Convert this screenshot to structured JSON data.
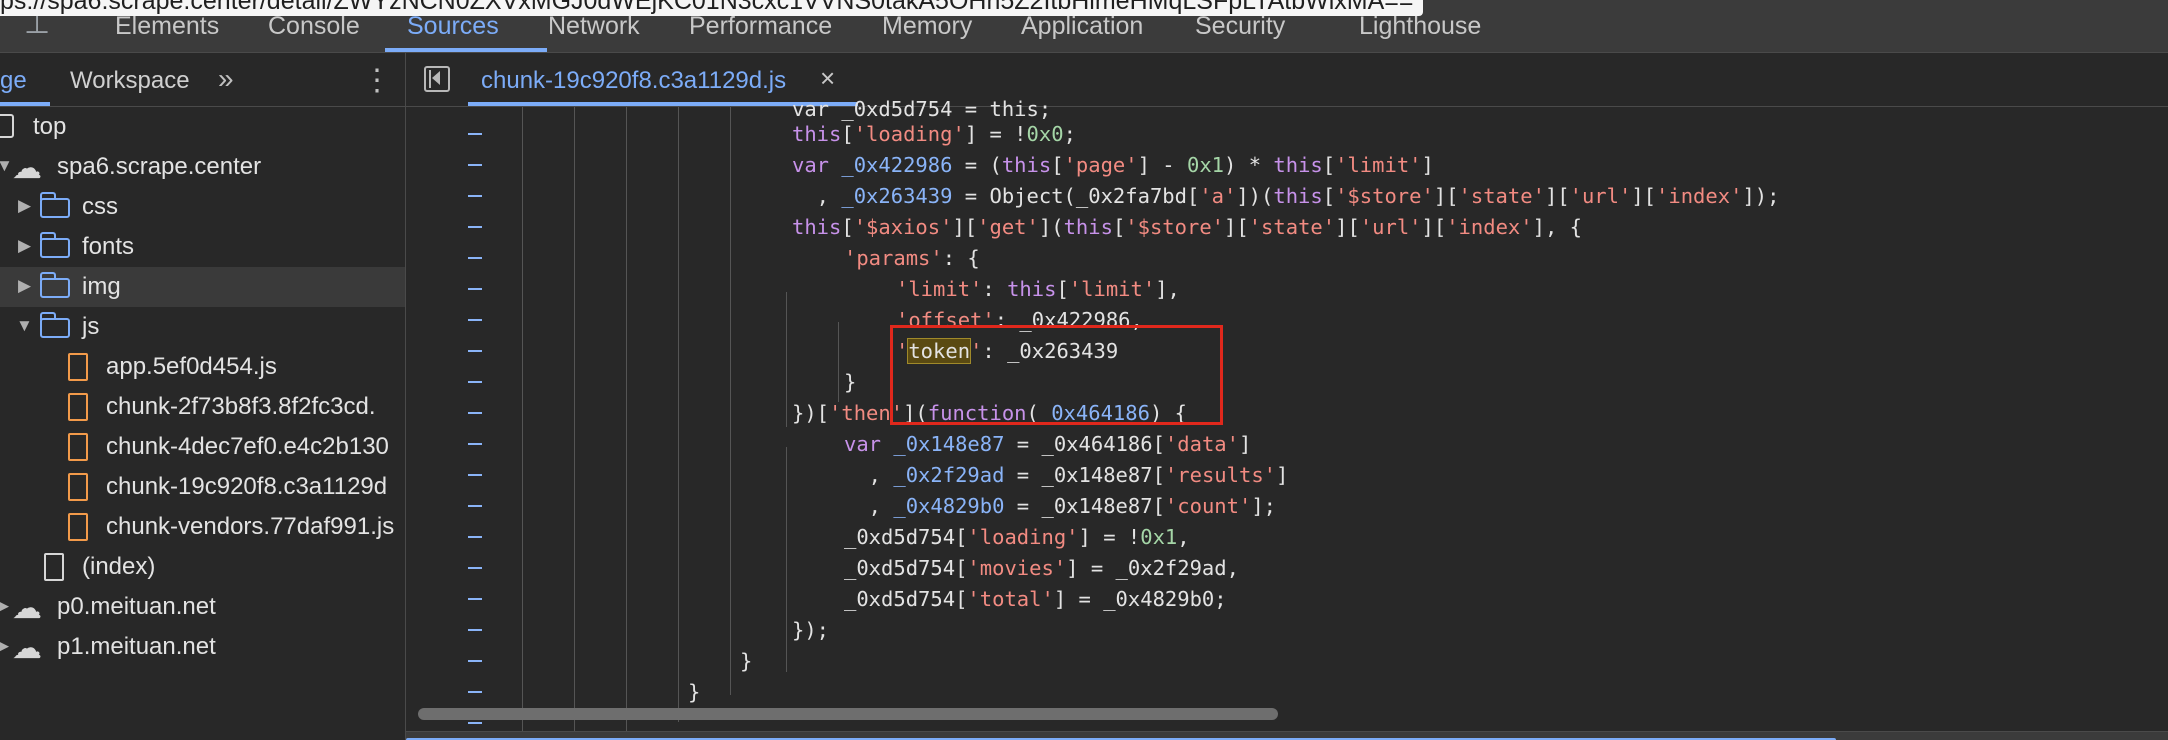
{
  "url_tooltip": "ps://spa6.scrape.center/detail/ZWYzNCN0ZXVxMGJ0dWEjKC01N3cxc1VVNS0takA5OHh5Z2ItbHlmeHMqLSFpLTAtbWlxMA==",
  "main_tabs": {
    "elements": "Elements",
    "console": "Console",
    "sources": "Sources",
    "network": "Network",
    "performance": "Performance",
    "memory": "Memory",
    "application": "Application",
    "security": "Security",
    "lighthouse": "Lighthouse"
  },
  "navigator": {
    "tab_page": "ge",
    "tab_workspace": "Workspace",
    "more_tabs": "»",
    "menu": "⋮",
    "tree": {
      "top": "top",
      "domain": "spa6.scrape.center",
      "css": "css",
      "fonts": "fonts",
      "img": "img",
      "js": "js",
      "file1": "app.5ef0d454.js",
      "file2": "chunk-2f73b8f3.8f2fc3cd.",
      "file3": "chunk-4dec7ef0.e4c2b130",
      "file4": "chunk-19c920f8.c3a1129d",
      "file5": "chunk-vendors.77daf991.js",
      "index": "(index)",
      "p0": "p0.meituan.net",
      "p1": "p1.meituan.net"
    }
  },
  "editor": {
    "tab_name": "chunk-19c920f8.c3a1129d.js",
    "tab_close": "×",
    "selected_token": "token"
  },
  "code": {
    "l0": "var _0xd5d754 = this;",
    "l1_a": "this",
    "l1_b": "[",
    "l1_c": "'loading'",
    "l1_d": "] = !",
    "l1_e": "0x0",
    "l1_f": ";",
    "l2_a": "var ",
    "l2_b": "_0x422986",
    "l2_c": " = (",
    "l2_d": "this",
    "l2_e": "[",
    "l2_f": "'page'",
    "l2_g": "] - ",
    "l2_h": "0x1",
    "l2_i": ") * ",
    "l2_j": "this",
    "l2_k": "[",
    "l2_l": "'limit'",
    "l2_m": "]",
    "l3_a": "  , ",
    "l3_b": "_0x263439",
    "l3_c": " = Object(_0x2fa7bd[",
    "l3_d": "'a'",
    "l3_e": "])(",
    "l3_f": "this",
    "l3_g": "[",
    "l3_h": "'$store'",
    "l3_i": "][",
    "l3_j": "'state'",
    "l3_k": "][",
    "l3_l": "'url'",
    "l3_m": "][",
    "l3_n": "'index'",
    "l3_o": "]);",
    "l4_a": "this",
    "l4_b": "[",
    "l4_c": "'$axios'",
    "l4_d": "][",
    "l4_e": "'get'",
    "l4_f": "](",
    "l4_g": "this",
    "l4_h": "[",
    "l4_i": "'$store'",
    "l4_j": "][",
    "l4_k": "'state'",
    "l4_l": "][",
    "l4_m": "'url'",
    "l4_n": "][",
    "l4_o": "'index'",
    "l4_p": "], {",
    "l5_a": "'params'",
    "l5_b": ": {",
    "l6_a": "'limit'",
    "l6_b": ": ",
    "l6_c": "this",
    "l6_d": "[",
    "l6_e": "'limit'",
    "l6_f": "],",
    "l7_a": "'offset'",
    "l7_b": ": _0x422986,",
    "l8_a": "'",
    "l8_c": "'",
    "l8_d": ": _0x263439",
    "l9": "}",
    "l10_a": "})[",
    "l10_b": "'then'",
    "l10_c": "](",
    "l10_d": "function",
    "l10_e": "(",
    "l10_f": "_0x464186",
    "l10_g": ") {",
    "l11_a": "var ",
    "l11_b": "_0x148e87",
    "l11_c": " = _0x464186[",
    "l11_d": "'data'",
    "l11_e": "]",
    "l12_a": "  , ",
    "l12_b": "_0x2f29ad",
    "l12_c": " = _0x148e87[",
    "l12_d": "'results'",
    "l12_e": "]",
    "l13_a": "  , ",
    "l13_b": "_0x4829b0",
    "l13_c": " = _0x148e87[",
    "l13_d": "'count'",
    "l13_e": "];",
    "l14_a": "_0xd5d754[",
    "l14_b": "'loading'",
    "l14_c": "] = !",
    "l14_d": "0x1",
    "l14_e": ",",
    "l15_a": "_0xd5d754[",
    "l15_b": "'movies'",
    "l15_c": "] = _0x2f29ad,",
    "l16_a": "_0xd5d754[",
    "l16_b": "'total'",
    "l16_c": "] = _0x4829b0;",
    "l17": "});",
    "l18": "}",
    "l19": "}"
  }
}
